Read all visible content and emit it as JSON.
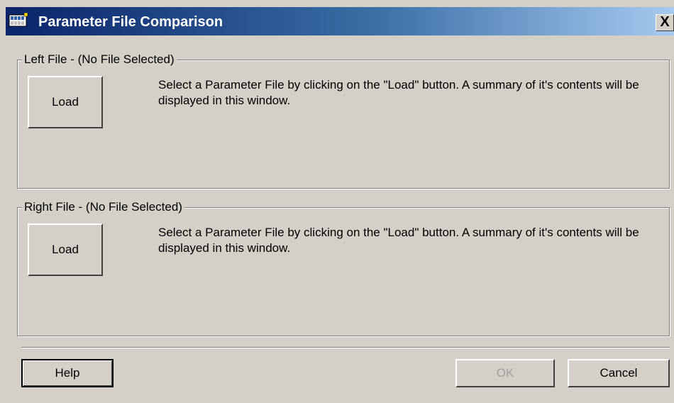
{
  "window": {
    "title": "Parameter File Comparison",
    "close_label": "X",
    "icon": "app-grid-icon"
  },
  "left_group": {
    "legend": "Left File - (No File Selected)",
    "load_label": "Load",
    "summary": "Select a  Parameter File by clicking on the \"Load\" button. A summary of it's contents will be displayed in this window."
  },
  "right_group": {
    "legend": "Right File - (No File Selected)",
    "load_label": "Load",
    "summary": "Select a  Parameter File by clicking on the \"Load\" button. A summary of it's contents will be displayed in this window."
  },
  "footer": {
    "help_label": "Help",
    "ok_label": "OK",
    "cancel_label": "Cancel"
  },
  "colors": {
    "title_bar_start": "#0a246a",
    "title_bar_end": "#a6caf0",
    "dialog_face": "#d4d0c8",
    "disabled_text": "#a0a0a0"
  }
}
